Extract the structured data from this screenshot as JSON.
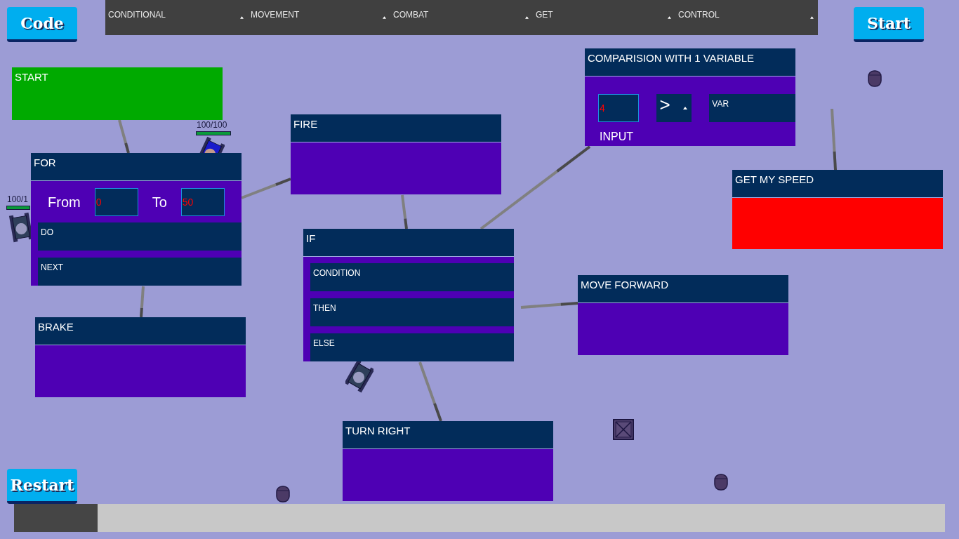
{
  "buttons": {
    "code": "Code",
    "start": "Start",
    "restart": "Restart"
  },
  "menu": [
    {
      "label": "CONDITIONAL"
    },
    {
      "label": "MOVEMENT"
    },
    {
      "label": "COMBAT"
    },
    {
      "label": "GET"
    },
    {
      "label": "CONTROL"
    }
  ],
  "units": [
    {
      "kind": "tank",
      "health": "100/100",
      "level": 1
    },
    {
      "kind": "tank",
      "health": "100/1",
      "level": 1
    },
    {
      "kind": "tank"
    }
  ],
  "props": [
    {
      "kind": "barrel"
    },
    {
      "kind": "barrel"
    },
    {
      "kind": "barrel"
    },
    {
      "kind": "crate"
    }
  ],
  "blocks": [
    {
      "title": "START",
      "kind": "start"
    },
    {
      "title": "FOR",
      "kind": "action",
      "rows": [
        [
          {
            "kind": "label",
            "text": "From"
          },
          {
            "kind": "input",
            "value": "0"
          },
          {
            "kind": "label",
            "text": "To"
          },
          {
            "kind": "input",
            "value": "50"
          }
        ],
        [
          {
            "kind": "slot",
            "label": "DO"
          }
        ],
        [
          {
            "kind": "slot",
            "label": "NEXT"
          }
        ]
      ]
    },
    {
      "title": "FIRE",
      "kind": "action"
    },
    {
      "title": "IF",
      "kind": "action",
      "rows": [
        [
          {
            "kind": "slot",
            "label": "CONDITION"
          }
        ],
        [
          {
            "kind": "slot",
            "label": "THEN"
          }
        ],
        [
          {
            "kind": "slot",
            "label": "ELSE"
          }
        ]
      ]
    },
    {
      "title": "COMPARISION WITH 1 VARIABLE",
      "kind": "action",
      "rows": [
        [
          {
            "kind": "input",
            "value": "4"
          },
          {
            "kind": "dropdown",
            "value": ">"
          },
          {
            "kind": "slot",
            "label": "VAR"
          }
        ],
        [
          {
            "kind": "label",
            "text": "INPUT"
          }
        ]
      ]
    },
    {
      "title": "GET MY SPEED",
      "kind": "sensor"
    },
    {
      "title": "MOVE FORWARD",
      "kind": "action"
    },
    {
      "title": "BRAKE",
      "kind": "action"
    },
    {
      "title": "TURN RIGHT",
      "kind": "action"
    }
  ],
  "progress": {
    "level": 0.09
  }
}
